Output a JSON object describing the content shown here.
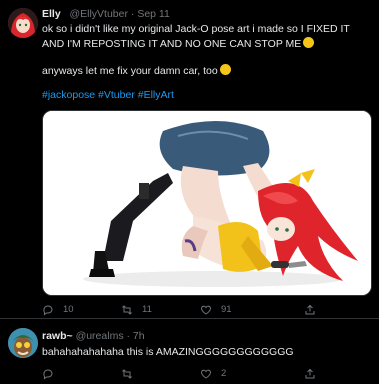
{
  "tweet1": {
    "author_name": "Elly",
    "author_handle": "@EllyVtuber",
    "separator": "·",
    "date": "Sep 11",
    "text_line1": "ok so i didn't like my original Jack-O pose art i made so I FIXED IT AND I'M REPOSTING IT AND NO ONE CAN STOP ME",
    "text_line2": "anyways let me fix your damn car, too",
    "hashtags": [
      "#jackopose",
      "#Vtuber",
      "#EllyArt"
    ],
    "reply_count": "10",
    "retweet_count": "11",
    "like_count": "91"
  },
  "tweet2": {
    "author_name": "rawb~",
    "author_handle": "@urealms",
    "separator": "·",
    "date": "7h",
    "text": "bahahahahahaha this is AMAZINGGGGGGGGGGGG",
    "like_count": "2"
  },
  "colors": {
    "background": "#000000",
    "text": "#e7e9ea",
    "muted": "#71767b",
    "link": "#1d9bf0",
    "hair_red": "#e0242c",
    "jacket_yellow": "#f2c21b"
  },
  "icons": [
    "reply-icon",
    "retweet-icon",
    "like-icon",
    "share-icon"
  ]
}
